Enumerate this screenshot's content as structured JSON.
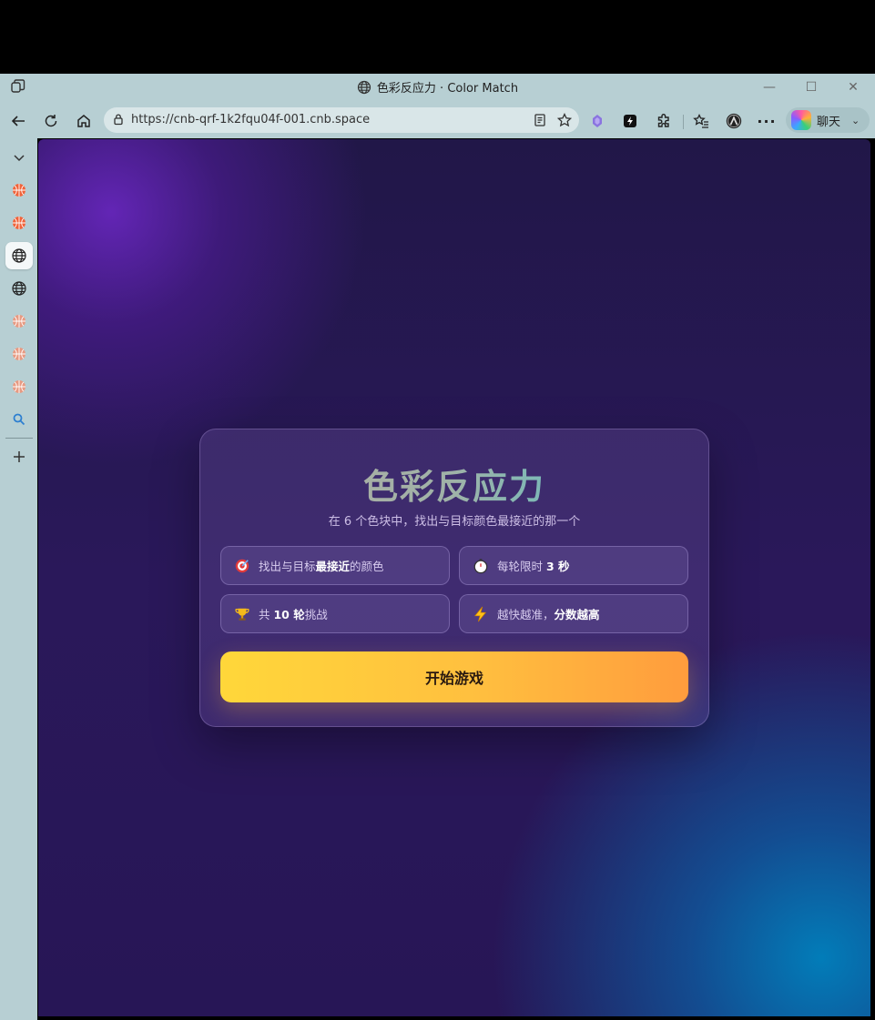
{
  "window": {
    "title": "色彩反应力 · Color Match",
    "minimize_icon": "minimize-icon",
    "maximize_icon": "maximize-icon",
    "close_icon": "close-icon"
  },
  "toolbar": {
    "url": "https://cnb-qrf-1k2fqu04f-001.cnb.space",
    "copilot_label": "聊天"
  },
  "sidebar": {
    "items": [
      {
        "name": "collapse-chevron-icon"
      },
      {
        "name": "tab-icon-1"
      },
      {
        "name": "tab-icon-2"
      },
      {
        "name": "globe-icon-active"
      },
      {
        "name": "globe-icon"
      },
      {
        "name": "tab-icon-3"
      },
      {
        "name": "tab-icon-4"
      },
      {
        "name": "tab-icon-5"
      },
      {
        "name": "search-icon"
      },
      {
        "name": "add-icon"
      }
    ]
  },
  "game": {
    "title": "色彩反应力",
    "subtitle": "在 6 个色块中，找出与目标颜色最接近的那一个",
    "features": [
      {
        "icon": "target-icon",
        "pre": "找出与目标",
        "bold": "最接近",
        "post": "的颜色"
      },
      {
        "icon": "stopwatch-icon",
        "pre": "每轮限时 ",
        "bold": "3 秒",
        "post": ""
      },
      {
        "icon": "trophy-icon",
        "pre": "共 ",
        "bold": "10 轮",
        "post": "挑战"
      },
      {
        "icon": "lightning-icon",
        "pre": "越快越准，",
        "bold": "分数越高",
        "post": ""
      }
    ],
    "start_button": "开始游戏"
  },
  "colors": {
    "accent_button_start": "#ffd73a",
    "accent_button_end": "#ff9c3d",
    "background": "#2a185a"
  }
}
